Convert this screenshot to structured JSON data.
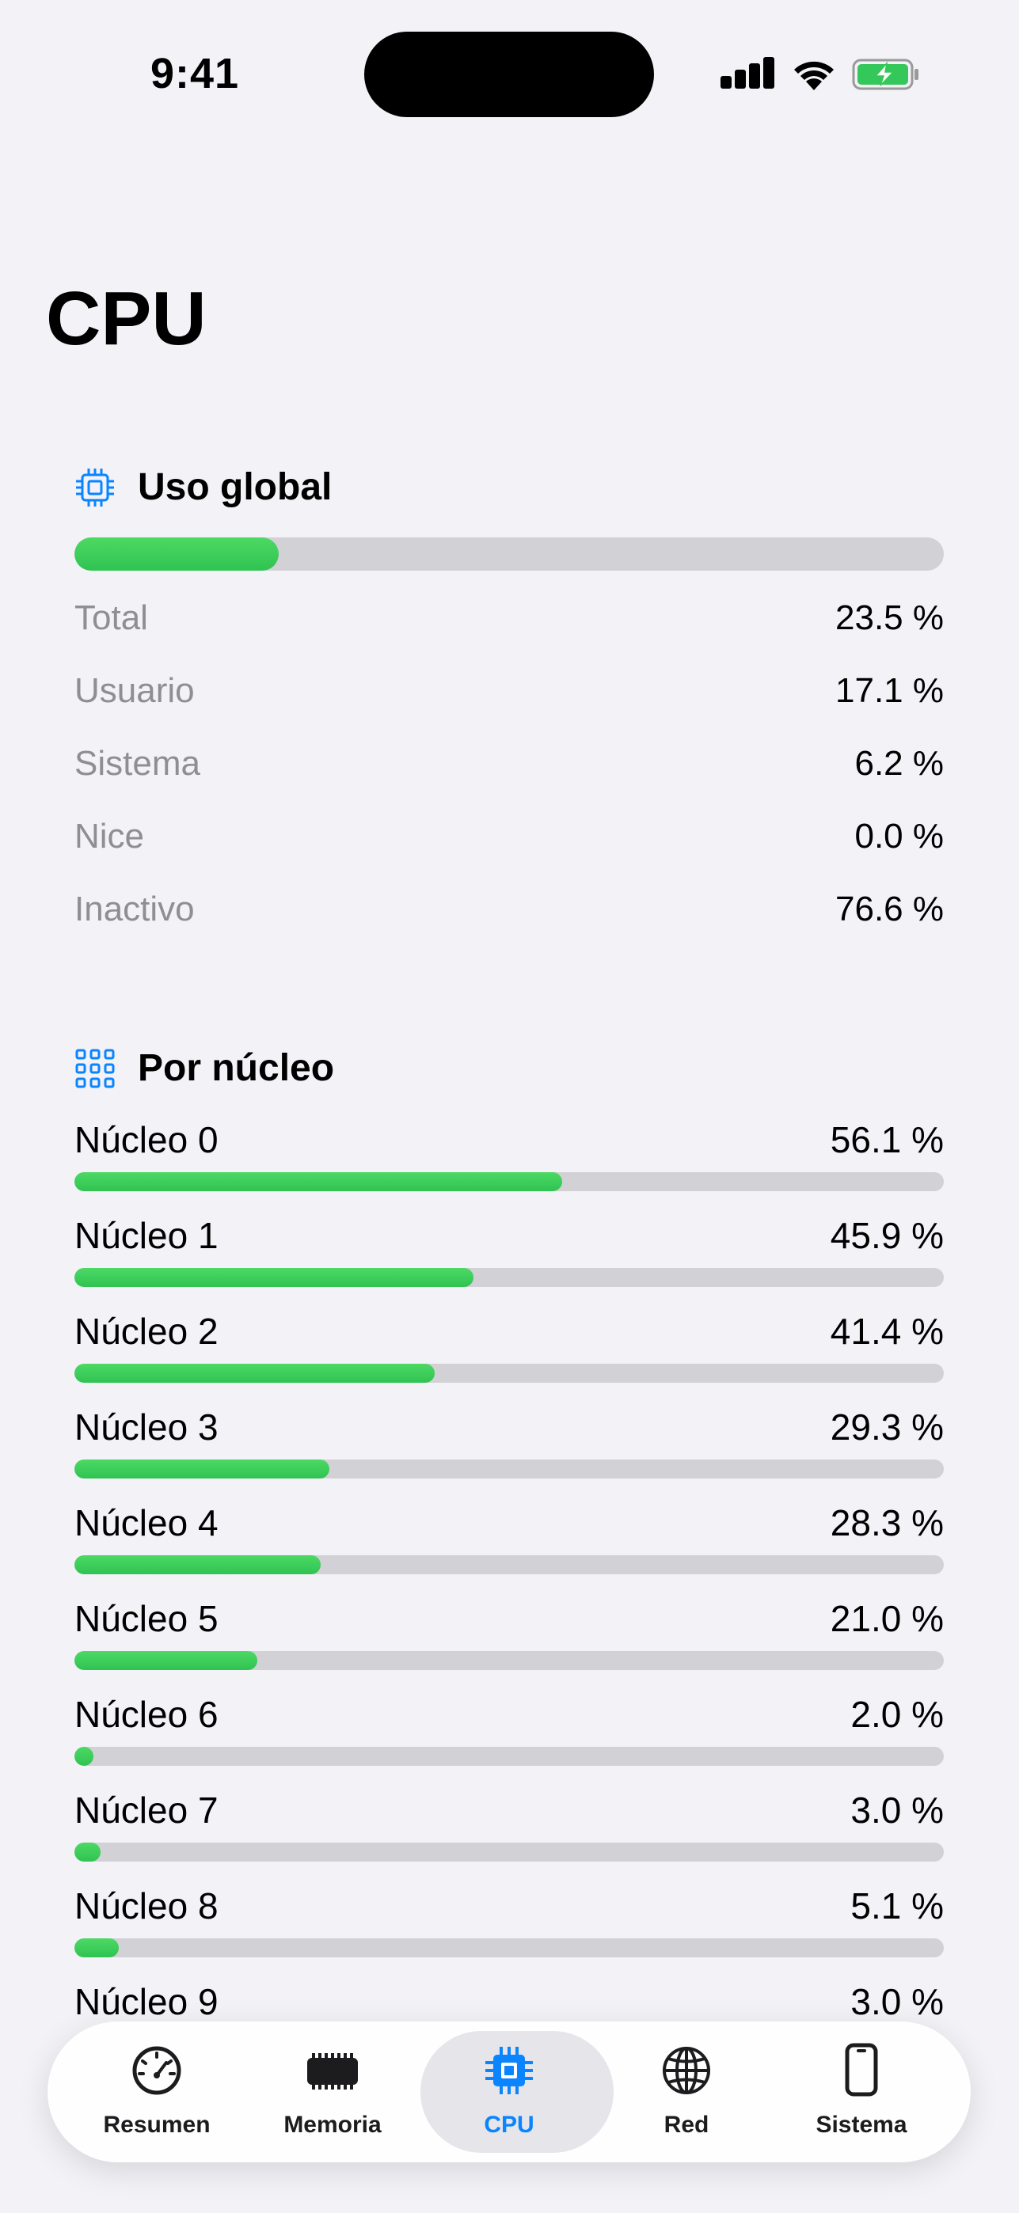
{
  "status": {
    "time": "9:41"
  },
  "title": "CPU",
  "global": {
    "header": "Uso global",
    "usage_fraction": 0.235,
    "rows": [
      {
        "label": "Total",
        "value": "23.5 %"
      },
      {
        "label": "Usuario",
        "value": "17.1 %"
      },
      {
        "label": "Sistema",
        "value": "6.2 %"
      },
      {
        "label": "Nice",
        "value": "0.0 %"
      },
      {
        "label": "Inactivo",
        "value": "76.6 %"
      }
    ]
  },
  "cores": {
    "header": "Por núcleo",
    "items": [
      {
        "label": "Núcleo 0",
        "value": "56.1 %",
        "fraction": 0.561
      },
      {
        "label": "Núcleo 1",
        "value": "45.9 %",
        "fraction": 0.459
      },
      {
        "label": "Núcleo 2",
        "value": "41.4 %",
        "fraction": 0.414
      },
      {
        "label": "Núcleo 3",
        "value": "29.3 %",
        "fraction": 0.293
      },
      {
        "label": "Núcleo 4",
        "value": "28.3 %",
        "fraction": 0.283
      },
      {
        "label": "Núcleo 5",
        "value": "21.0 %",
        "fraction": 0.21
      },
      {
        "label": "Núcleo 6",
        "value": "2.0 %",
        "fraction": 0.02
      },
      {
        "label": "Núcleo 7",
        "value": "3.0 %",
        "fraction": 0.03
      },
      {
        "label": "Núcleo 8",
        "value": "5.1 %",
        "fraction": 0.051
      },
      {
        "label": "Núcleo 9",
        "value": "3.0 %",
        "fraction": 0.03
      }
    ]
  },
  "tabs": [
    {
      "label": "Resumen",
      "icon": "speedometer-icon"
    },
    {
      "label": "Memoria",
      "icon": "memory-chip-icon"
    },
    {
      "label": "CPU",
      "icon": "cpu-icon",
      "active": true
    },
    {
      "label": "Red",
      "icon": "globe-icon"
    },
    {
      "label": "Sistema",
      "icon": "phone-icon"
    }
  ],
  "colors": {
    "accent": "#0a84ff",
    "bar_fill": "#34c759",
    "bar_track": "#d1d1d6"
  }
}
